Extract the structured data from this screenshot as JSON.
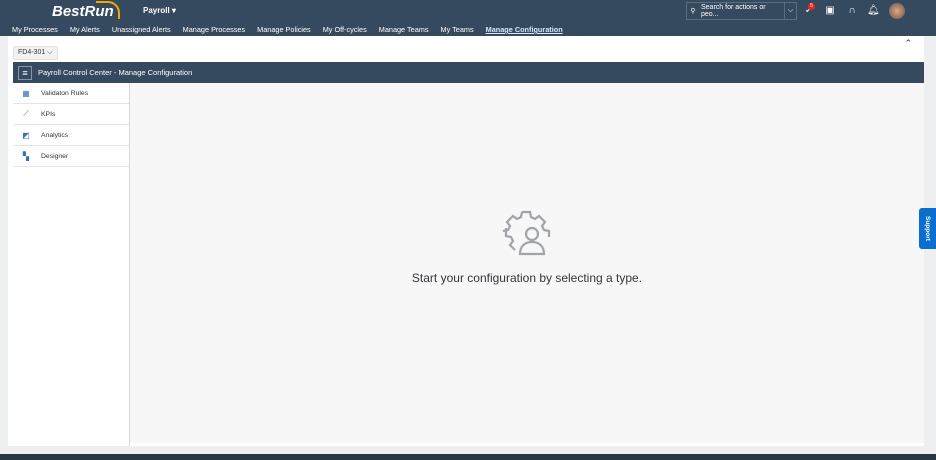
{
  "shell": {
    "logo": "BestRun",
    "app_title": "Payroll ▾",
    "search_placeholder": "Search for actions or peo...",
    "notification_count": "5",
    "nav": [
      "My Processes",
      "My Alerts",
      "Unassigned Alerts",
      "Manage Processes",
      "Manage Policies",
      "My Off-cycles",
      "Manage Teams",
      "My Teams",
      "Manage Configuration"
    ]
  },
  "system": "FD4-301 ⌵",
  "bar_title": "Payroll Control Center - Manage Configuration",
  "sidebar": [
    "Validaton Rules",
    "KPIs",
    "Analytics",
    "Designer"
  ],
  "empty_message": "Start your configuration by selecting a type.",
  "support": "Support"
}
